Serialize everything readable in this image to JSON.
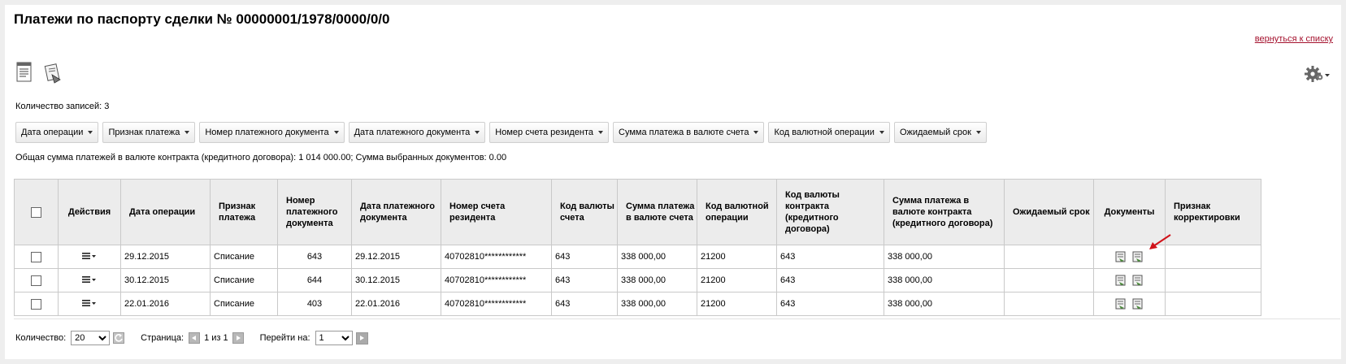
{
  "page": {
    "title": "Платежи по паспорту сделки № 00000001/1978/0000/0/0",
    "back_link": "вернуться к списку"
  },
  "toolbar": {
    "icons": [
      "report-icon",
      "export-document-icon",
      "settings-gear-icon"
    ]
  },
  "records_count_text": "Количество записей: 3",
  "filters": [
    "Дата операции",
    "Признак платежа",
    "Номер платежного документа",
    "Дата платежного документа",
    "Номер счета резидента",
    "Сумма платежа в валюте счета",
    "Код валютной операции",
    "Ожидаемый срок"
  ],
  "summary_text": "Общая сумма платежей в валюте контракта (кредитного договора): 1 014 000.00; Сумма выбранных документов: 0.00",
  "table": {
    "headers": {
      "actions": "Действия",
      "operation_date": "Дата операции",
      "payment_sign": "Признак платежа",
      "doc_number": "Номер платежного документа",
      "doc_date": "Дата платежного документа",
      "resident_account": "Номер счета резидента",
      "account_currency_code": "Код валюты счета",
      "amount_account_currency": "Сумма платежа в валюте счета",
      "currency_operation_code": "Код валютной операции",
      "contract_currency_code": "Код валюты контракта (кредитного договора)",
      "amount_contract_currency": "Сумма платежа в валюте контракта (кредитного договора)",
      "expected_term": "Ожидаемый срок",
      "documents": "Документы",
      "correction_sign": "Признак корректировки"
    },
    "rows": [
      {
        "operation_date": "29.12.2015",
        "payment_sign": "Списание",
        "doc_number": "643",
        "doc_date": "29.12.2015",
        "resident_account": "40702810************",
        "account_currency_code": "643",
        "amount_account_currency": "338 000,00",
        "currency_operation_code": "21200",
        "contract_currency_code": "643",
        "amount_contract_currency": "338 000,00",
        "expected_term": "",
        "correction_sign": ""
      },
      {
        "operation_date": "30.12.2015",
        "payment_sign": "Списание",
        "doc_number": "644",
        "doc_date": "30.12.2015",
        "resident_account": "40702810************",
        "account_currency_code": "643",
        "amount_account_currency": "338 000,00",
        "currency_operation_code": "21200",
        "contract_currency_code": "643",
        "amount_contract_currency": "338 000,00",
        "expected_term": "",
        "correction_sign": ""
      },
      {
        "operation_date": "22.01.2016",
        "payment_sign": "Списание",
        "doc_number": "403",
        "doc_date": "22.01.2016",
        "resident_account": "40702810************",
        "account_currency_code": "643",
        "amount_account_currency": "338 000,00",
        "currency_operation_code": "21200",
        "contract_currency_code": "643",
        "amount_contract_currency": "338 000,00",
        "expected_term": "",
        "correction_sign": ""
      }
    ]
  },
  "pager": {
    "count_label": "Количество:",
    "count_value": "20",
    "page_label": "Страница:",
    "page_info": "1 из 1",
    "goto_label": "Перейти на:",
    "goto_value": "1"
  },
  "colors": {
    "link": "#a4112d",
    "header_bg": "#ececec",
    "arrow": "#d0121a"
  }
}
